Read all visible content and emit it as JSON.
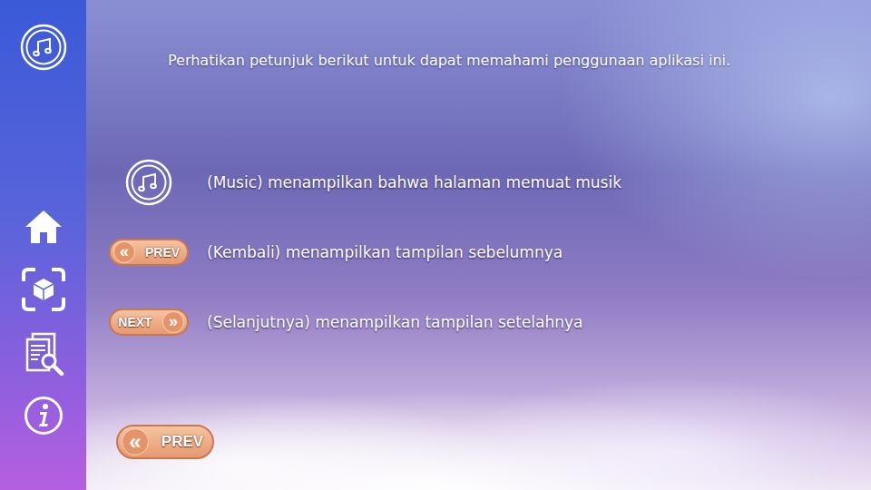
{
  "header": {
    "instruction": "Perhatikan petunjuk berikut untuk dapat memahami penggunaan aplikasi ini."
  },
  "legend": [
    {
      "kind": "music",
      "label": "",
      "glyph": "",
      "description": "(Music) menampilkan bahwa halaman memuat musik"
    },
    {
      "kind": "prev",
      "label": "PREV",
      "glyph": "«",
      "description": "(Kembali) menampilkan tampilan sebelumnya"
    },
    {
      "kind": "next",
      "label": "NEXT",
      "glyph": "»",
      "description": "(Selanjutnya) menampilkan tampilan setelahnya"
    }
  ],
  "footer": {
    "button": {
      "label": "PREV",
      "glyph": "«"
    }
  }
}
